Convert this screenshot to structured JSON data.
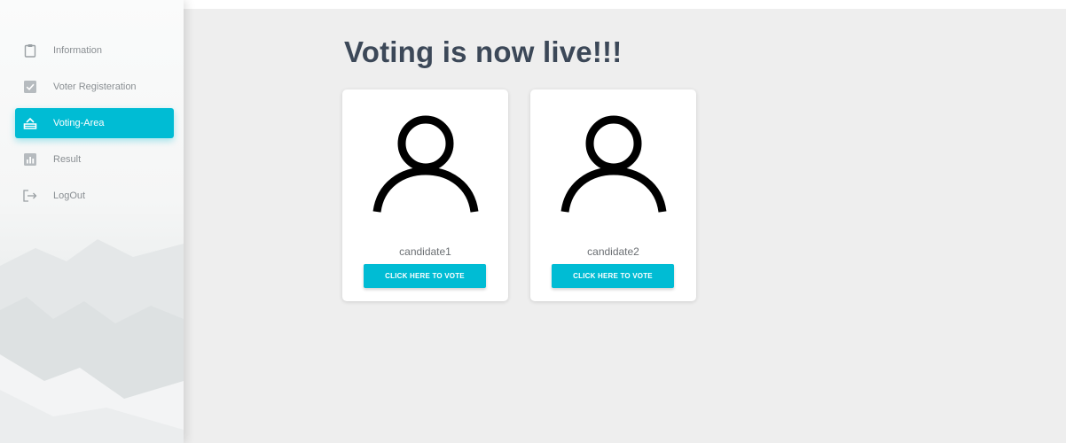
{
  "sidebar": {
    "items": [
      {
        "label": "Information",
        "icon": "clipboard-icon",
        "active": false
      },
      {
        "label": "Voter Registeration",
        "icon": "checkbox-icon",
        "active": false
      },
      {
        "label": "Voting-Area",
        "icon": "ballot-box-icon",
        "active": true
      },
      {
        "label": "Result",
        "icon": "bar-chart-icon",
        "active": false
      },
      {
        "label": "LogOut",
        "icon": "logout-icon",
        "active": false
      }
    ]
  },
  "main": {
    "title": "Voting is now live!!!",
    "candidates": [
      {
        "name": "candidate1",
        "button_label": "CLICK HERE TO VOTE",
        "icon": "person-icon"
      },
      {
        "name": "candidate2",
        "button_label": "CLICK HERE TO VOTE",
        "icon": "person-icon"
      }
    ]
  },
  "colors": {
    "accent": "#00bcd4",
    "title": "#3c4858",
    "background": "#eeeeee",
    "nav_text": "#8a8f93"
  }
}
